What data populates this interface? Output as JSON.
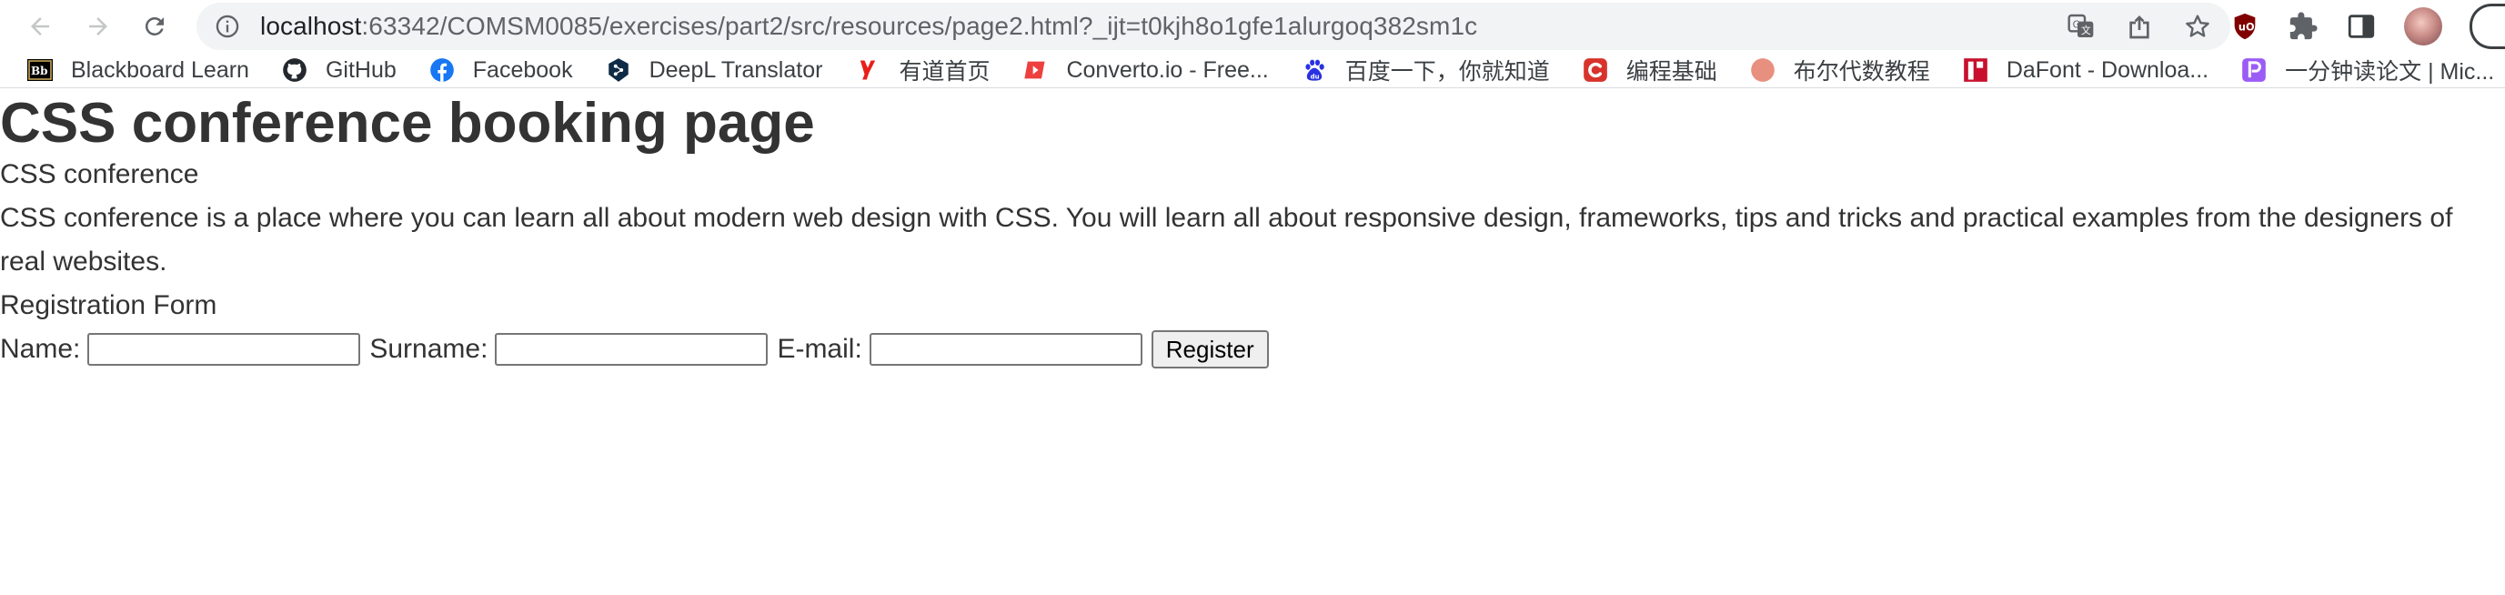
{
  "browser": {
    "url_host": "localhost",
    "url_rest": ":63342/COMSM0085/exercises/part2/src/resources/page2.html?_ijt=t0kjh8o1gfe1alurgoq382sm1c",
    "bookmarks": [
      {
        "label": "Blackboard Learn",
        "icon": "blackboard-icon",
        "color": "#000000"
      },
      {
        "label": "GitHub",
        "icon": "github-icon",
        "color": "#24292f"
      },
      {
        "label": "Facebook",
        "icon": "facebook-icon",
        "color": "#1877f2"
      },
      {
        "label": "DeepL Translator",
        "icon": "deepl-icon",
        "color": "#0f2b46"
      },
      {
        "label": "有道首页",
        "icon": "youdao-icon",
        "color": "#e7211a"
      },
      {
        "label": "Converto.io - Free...",
        "icon": "converto-icon",
        "color": "#ee3f3f"
      },
      {
        "label": "百度一下，你就知道",
        "icon": "baidu-icon",
        "color": "#2932e1"
      },
      {
        "label": "编程基础",
        "icon": "c-icon",
        "color": "#d7332c"
      },
      {
        "label": "布尔代数教程",
        "icon": "circle-icon",
        "color": "#e8907f"
      },
      {
        "label": "DaFont - Downloa...",
        "icon": "dafont-icon",
        "color": "#c8102e"
      },
      {
        "label": "一分钟读论文 | Mic...",
        "icon": "p-icon",
        "color": "#9b5cf6"
      }
    ]
  },
  "page": {
    "heading": "CSS conference booking page",
    "subtitle": "CSS conference",
    "description": "CSS conference is a place where you can learn all about modern web design with CSS. You will learn all about responsive design, frameworks, tips and tricks and practical examples from the designers of real websites.",
    "form_title": "Registration Form",
    "form": {
      "name_label": "Name:",
      "name_value": "",
      "surname_label": "Surname:",
      "surname_value": "",
      "email_label": "E-mail:",
      "email_value": "",
      "submit_label": "Register"
    }
  }
}
